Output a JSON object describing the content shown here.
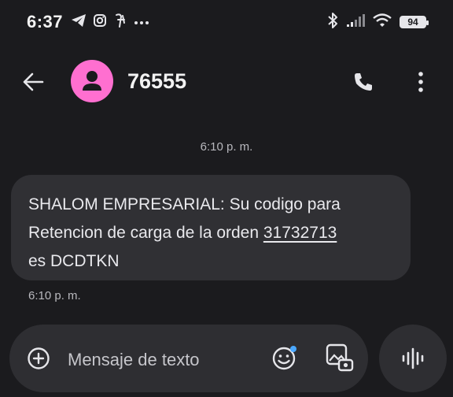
{
  "status_bar": {
    "time": "6:37",
    "icons_left": [
      "telegram-icon",
      "instagram-icon",
      "app-icon",
      "more-notifications-icon"
    ],
    "icons_right": [
      "bluetooth-icon",
      "signal-icon",
      "wifi-icon",
      "battery-icon"
    ],
    "battery_level": "94"
  },
  "app_bar": {
    "contact": "76555"
  },
  "conversation": {
    "timestamp_top": "6:10 p. m.",
    "message": {
      "line1": "SHALOM EMPRESARIAL: Su codigo para",
      "line2_prefix": "Retencion de carga de la orden ",
      "order_number": "31732713",
      "line3": "es DCDTKN"
    },
    "timestamp_message": "6:10 p. m."
  },
  "composer": {
    "placeholder": "Mensaje de texto"
  },
  "colors": {
    "background": "#1b1b1e",
    "bubble": "#303034",
    "avatar": "#ff6fd0",
    "emoji_badge": "#4aa8ff"
  }
}
